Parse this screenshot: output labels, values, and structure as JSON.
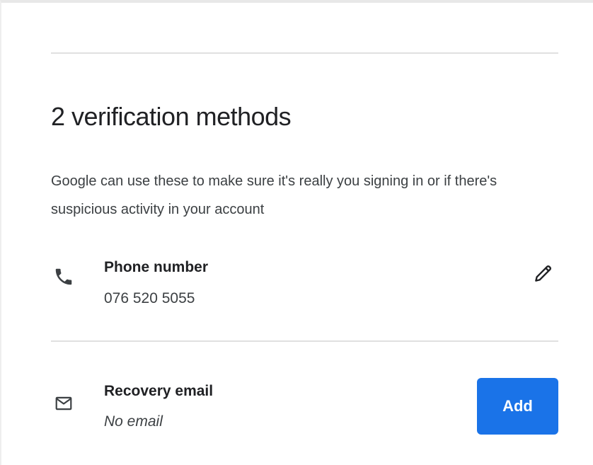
{
  "section": {
    "heading": "2 verification methods",
    "description": "Google can use these to make sure it's really you signing in or if there's suspicious activity in your account"
  },
  "methods": [
    {
      "icon": "phone-icon",
      "title": "Phone number",
      "value": "076 520 5055",
      "action_icon": "pencil-icon"
    },
    {
      "icon": "mail-icon",
      "title": "Recovery email",
      "value": "No email",
      "action_label": "Add"
    }
  ],
  "colors": {
    "accent": "#1a73e8",
    "text_primary": "#202124",
    "text_secondary": "#3c4043",
    "divider": "#e0e0e0"
  }
}
